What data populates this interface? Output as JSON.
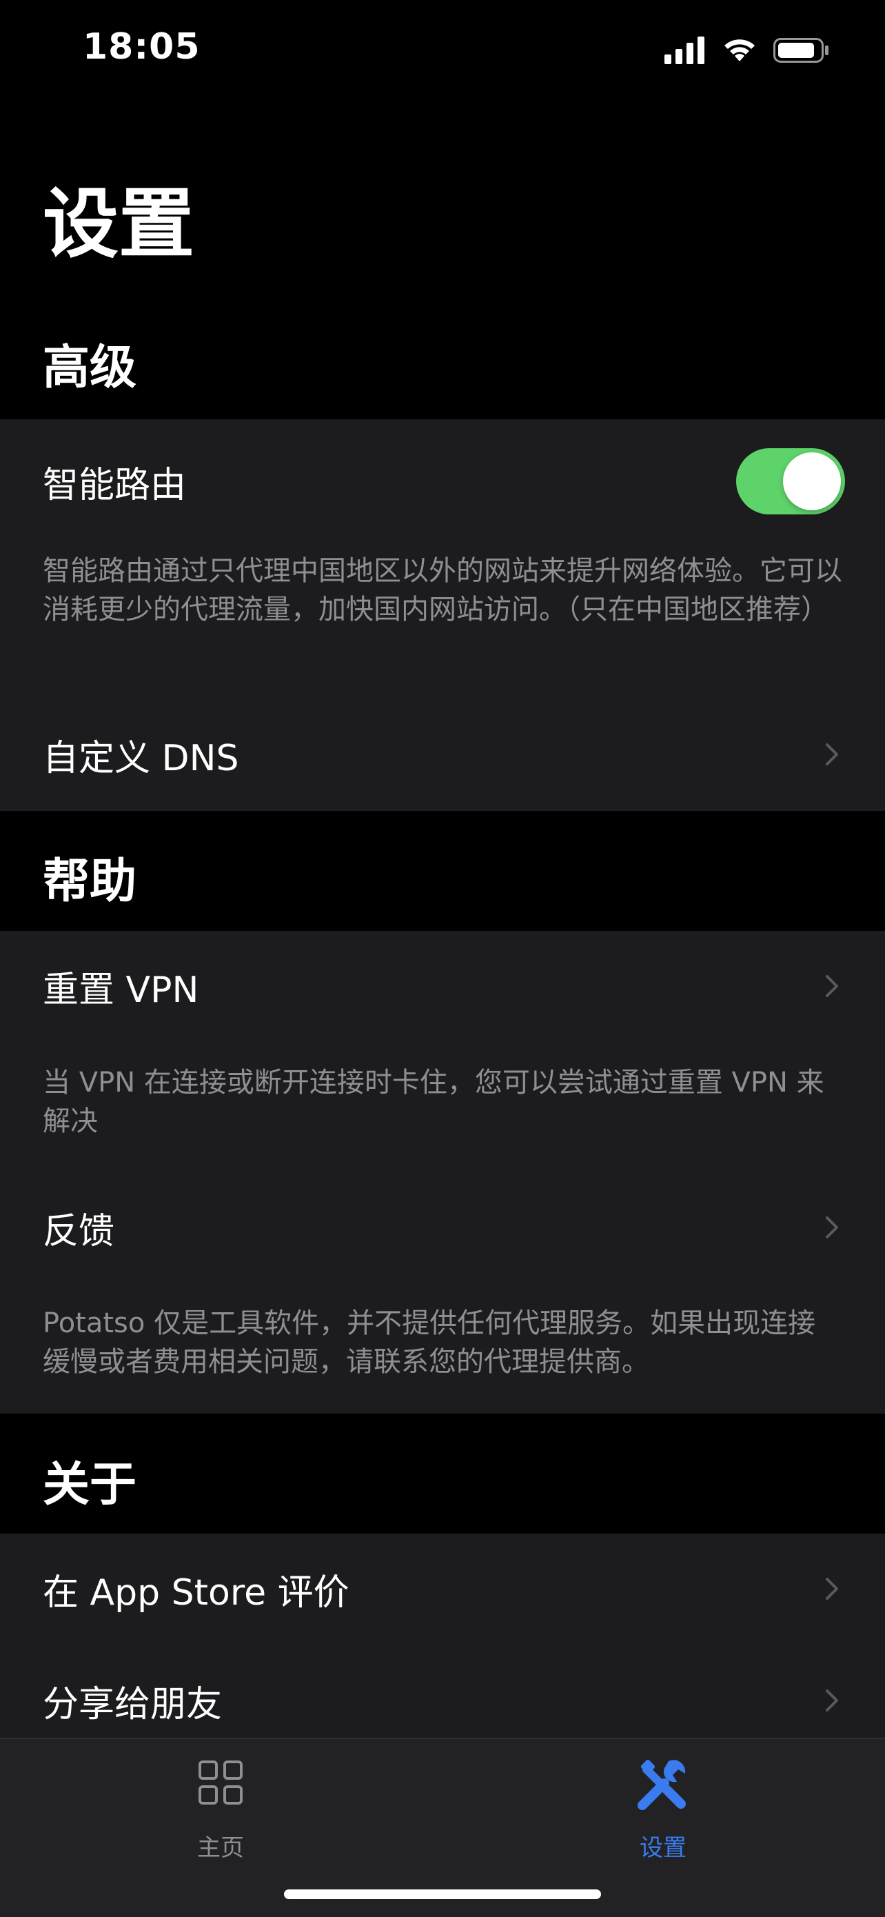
{
  "status_bar": {
    "time": "18:05"
  },
  "page": {
    "title": "设置"
  },
  "sections": {
    "advanced": {
      "header": "高级",
      "smart_routing": {
        "label": "智能路由",
        "enabled": true,
        "description": "智能路由通过只代理中国地区以外的网站来提升网络体验。它可以消耗更少的代理流量，加快国内网站访问。（只在中国地区推荐）"
      },
      "custom_dns": {
        "label": "自定义 DNS"
      }
    },
    "help": {
      "header": "帮助",
      "reset_vpn": {
        "label": "重置 VPN",
        "description": "当 VPN 在连接或断开连接时卡住，您可以尝试通过重置 VPN 来解决"
      },
      "feedback": {
        "label": "反馈",
        "description": "Potatso 仅是工具软件，并不提供任何代理服务。如果出现连接缓慢或者费用相关问题，请联系您的代理提供商。"
      }
    },
    "about": {
      "header": "关于",
      "rate_app_store": {
        "label": "在 App Store 评价"
      },
      "share_friends": {
        "label": "分享给朋友"
      }
    }
  },
  "tab_bar": {
    "tabs": [
      {
        "label": "主页",
        "icon": "grid-icon",
        "selected": false
      },
      {
        "label": "设置",
        "icon": "tools-icon",
        "selected": true
      }
    ]
  },
  "colors": {
    "accent": "#3a7bf0",
    "toggle_on": "#5ed36a",
    "group_bg": "#1c1c1e",
    "secondary_text": "#8e8e93"
  }
}
